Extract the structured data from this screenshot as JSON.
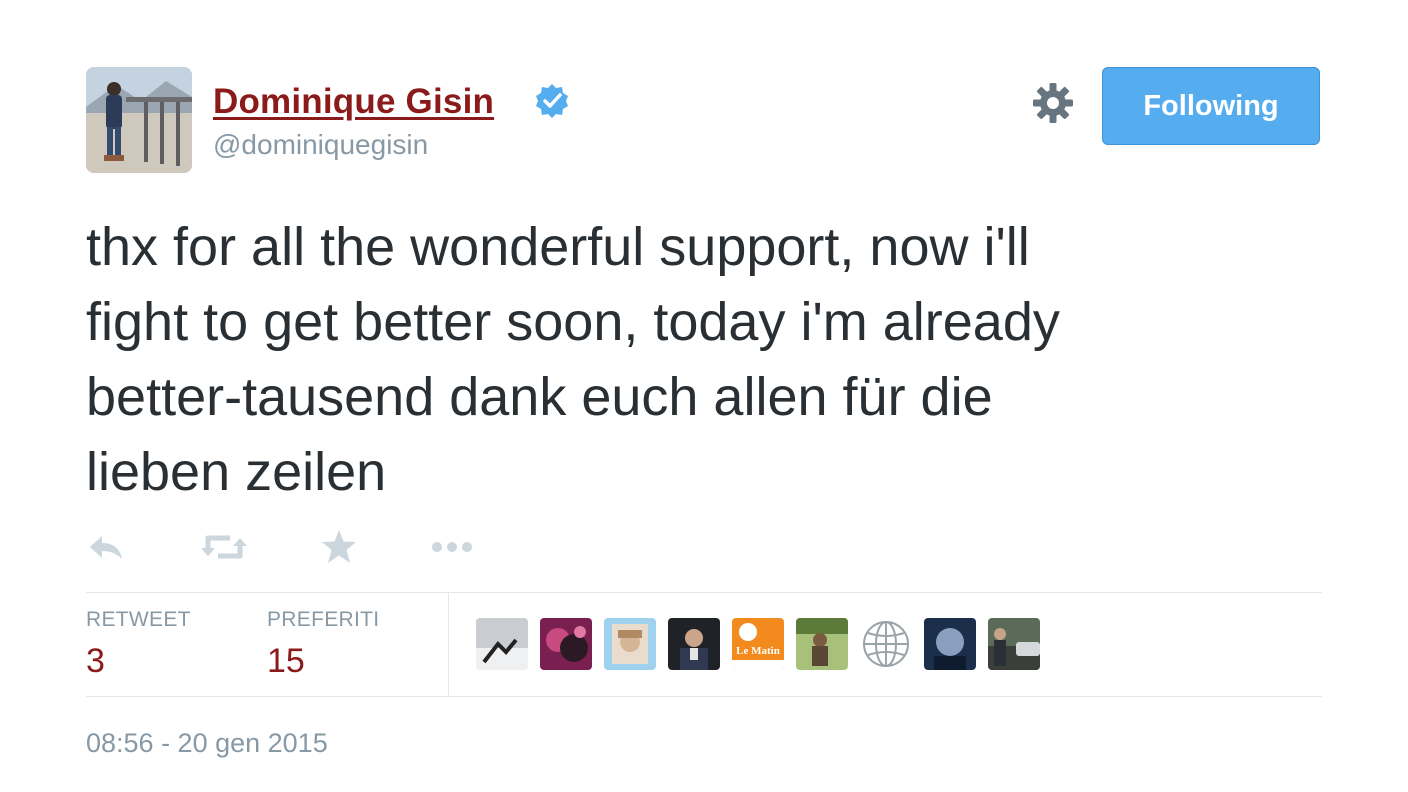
{
  "author": {
    "name": "Dominique Gisin",
    "handle": "@dominiquegisin",
    "verified": true
  },
  "follow_button": {
    "label": "Following",
    "color": "#55acee"
  },
  "tweet": {
    "text": "thx for all the wonderful support, now i'll\nfight to get better soon, today i'm already\nbetter-tausend dank euch allen für die\nlieben zeilen"
  },
  "actions": [
    "reply-icon",
    "retweet-icon",
    "favorite-icon",
    "more-icon"
  ],
  "stats": {
    "retweets": {
      "label": "RETWEET",
      "value": "3"
    },
    "favorites": {
      "label": "PREFERITI",
      "value": "15"
    }
  },
  "favoriters": [
    {
      "icon": "user-avatar",
      "color": "#8a8f96"
    },
    {
      "icon": "user-avatar",
      "color": "#b0306a"
    },
    {
      "icon": "user-avatar",
      "color": "#7ec3e6"
    },
    {
      "icon": "user-avatar",
      "color": "#2a2d33"
    },
    {
      "icon": "lematin-logo",
      "color": "#f28a1e",
      "logo_text": "Le Matin"
    },
    {
      "icon": "user-avatar",
      "color": "#6f8a4a"
    },
    {
      "icon": "globe-icon",
      "color": "#ffffff"
    },
    {
      "icon": "user-avatar",
      "color": "#27415e"
    },
    {
      "icon": "user-avatar",
      "color": "#4b5547"
    }
  ],
  "timestamp": "08:56 - 20 gen 2015",
  "colors": {
    "name": "#8b1a1a",
    "muted": "#8899a6",
    "text": "#292f33",
    "verified": "#55acee"
  }
}
